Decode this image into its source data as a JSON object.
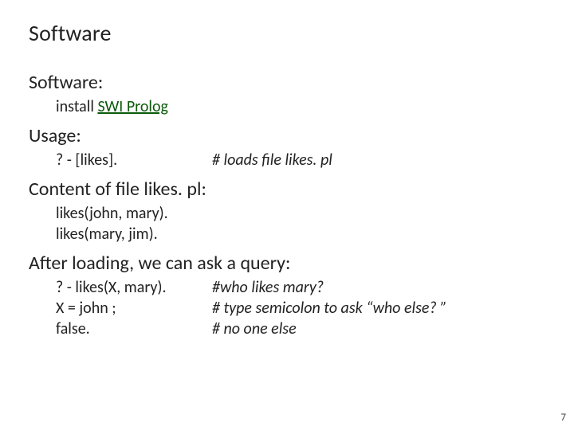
{
  "title": "Software",
  "sections": {
    "software": {
      "heading": "Software:",
      "install_prefix": "install ",
      "install_link": "SWI Prolog"
    },
    "usage": {
      "heading": "Usage:",
      "left": "? - [likes].",
      "right": "# loads file likes. pl"
    },
    "content": {
      "heading": "Content of file likes. pl:",
      "line1": "likes(john, mary).",
      "line2": "likes(mary, jim)."
    },
    "query": {
      "heading": "After loading, we can ask a query:",
      "rows": [
        {
          "left": "? - likes(X, mary).",
          "right": "#who likes mary?"
        },
        {
          "left": "X = john ;",
          "right": "# type semicolon to ask “who else? ”"
        },
        {
          "left": "false.",
          "right": "# no one else"
        }
      ]
    }
  },
  "page_number": "7"
}
